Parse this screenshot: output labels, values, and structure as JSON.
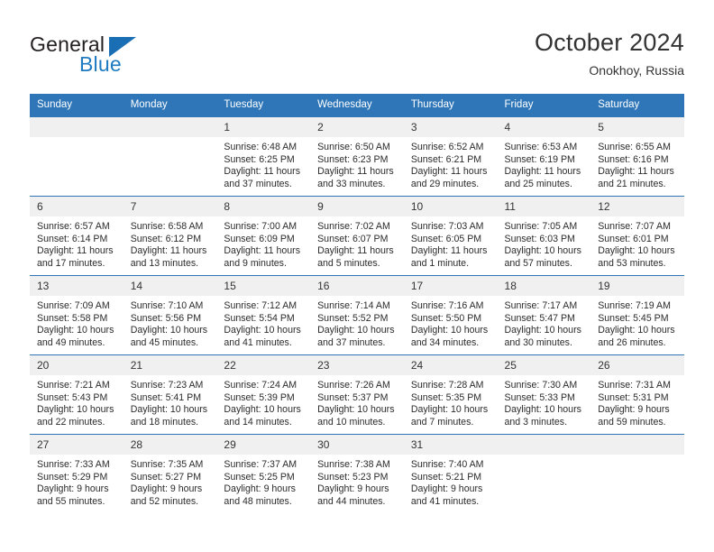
{
  "brand": {
    "name_top": "General",
    "name_bottom": "Blue",
    "triangle_color": "#1a6fb4",
    "blue_color": "#1f7ac0"
  },
  "header": {
    "title": "October 2024",
    "location": "Onokhoy, Russia"
  },
  "theme": {
    "header_blue": "#2e76b8",
    "daynum_band": "#f0f0f0",
    "text": "#2b2b2b"
  },
  "weekday_headers": [
    "Sunday",
    "Monday",
    "Tuesday",
    "Wednesday",
    "Thursday",
    "Friday",
    "Saturday"
  ],
  "weeks": [
    [
      {
        "day": "",
        "sunrise": "",
        "sunset": "",
        "daylight_line1": "",
        "daylight_line2": ""
      },
      {
        "day": "",
        "sunrise": "",
        "sunset": "",
        "daylight_line1": "",
        "daylight_line2": ""
      },
      {
        "day": "1",
        "sunrise": "Sunrise: 6:48 AM",
        "sunset": "Sunset: 6:25 PM",
        "daylight_line1": "Daylight: 11 hours",
        "daylight_line2": "and 37 minutes."
      },
      {
        "day": "2",
        "sunrise": "Sunrise: 6:50 AM",
        "sunset": "Sunset: 6:23 PM",
        "daylight_line1": "Daylight: 11 hours",
        "daylight_line2": "and 33 minutes."
      },
      {
        "day": "3",
        "sunrise": "Sunrise: 6:52 AM",
        "sunset": "Sunset: 6:21 PM",
        "daylight_line1": "Daylight: 11 hours",
        "daylight_line2": "and 29 minutes."
      },
      {
        "day": "4",
        "sunrise": "Sunrise: 6:53 AM",
        "sunset": "Sunset: 6:19 PM",
        "daylight_line1": "Daylight: 11 hours",
        "daylight_line2": "and 25 minutes."
      },
      {
        "day": "5",
        "sunrise": "Sunrise: 6:55 AM",
        "sunset": "Sunset: 6:16 PM",
        "daylight_line1": "Daylight: 11 hours",
        "daylight_line2": "and 21 minutes."
      }
    ],
    [
      {
        "day": "6",
        "sunrise": "Sunrise: 6:57 AM",
        "sunset": "Sunset: 6:14 PM",
        "daylight_line1": "Daylight: 11 hours",
        "daylight_line2": "and 17 minutes."
      },
      {
        "day": "7",
        "sunrise": "Sunrise: 6:58 AM",
        "sunset": "Sunset: 6:12 PM",
        "daylight_line1": "Daylight: 11 hours",
        "daylight_line2": "and 13 minutes."
      },
      {
        "day": "8",
        "sunrise": "Sunrise: 7:00 AM",
        "sunset": "Sunset: 6:09 PM",
        "daylight_line1": "Daylight: 11 hours",
        "daylight_line2": "and 9 minutes."
      },
      {
        "day": "9",
        "sunrise": "Sunrise: 7:02 AM",
        "sunset": "Sunset: 6:07 PM",
        "daylight_line1": "Daylight: 11 hours",
        "daylight_line2": "and 5 minutes."
      },
      {
        "day": "10",
        "sunrise": "Sunrise: 7:03 AM",
        "sunset": "Sunset: 6:05 PM",
        "daylight_line1": "Daylight: 11 hours",
        "daylight_line2": "and 1 minute."
      },
      {
        "day": "11",
        "sunrise": "Sunrise: 7:05 AM",
        "sunset": "Sunset: 6:03 PM",
        "daylight_line1": "Daylight: 10 hours",
        "daylight_line2": "and 57 minutes."
      },
      {
        "day": "12",
        "sunrise": "Sunrise: 7:07 AM",
        "sunset": "Sunset: 6:01 PM",
        "daylight_line1": "Daylight: 10 hours",
        "daylight_line2": "and 53 minutes."
      }
    ],
    [
      {
        "day": "13",
        "sunrise": "Sunrise: 7:09 AM",
        "sunset": "Sunset: 5:58 PM",
        "daylight_line1": "Daylight: 10 hours",
        "daylight_line2": "and 49 minutes."
      },
      {
        "day": "14",
        "sunrise": "Sunrise: 7:10 AM",
        "sunset": "Sunset: 5:56 PM",
        "daylight_line1": "Daylight: 10 hours",
        "daylight_line2": "and 45 minutes."
      },
      {
        "day": "15",
        "sunrise": "Sunrise: 7:12 AM",
        "sunset": "Sunset: 5:54 PM",
        "daylight_line1": "Daylight: 10 hours",
        "daylight_line2": "and 41 minutes."
      },
      {
        "day": "16",
        "sunrise": "Sunrise: 7:14 AM",
        "sunset": "Sunset: 5:52 PM",
        "daylight_line1": "Daylight: 10 hours",
        "daylight_line2": "and 37 minutes."
      },
      {
        "day": "17",
        "sunrise": "Sunrise: 7:16 AM",
        "sunset": "Sunset: 5:50 PM",
        "daylight_line1": "Daylight: 10 hours",
        "daylight_line2": "and 34 minutes."
      },
      {
        "day": "18",
        "sunrise": "Sunrise: 7:17 AM",
        "sunset": "Sunset: 5:47 PM",
        "daylight_line1": "Daylight: 10 hours",
        "daylight_line2": "and 30 minutes."
      },
      {
        "day": "19",
        "sunrise": "Sunrise: 7:19 AM",
        "sunset": "Sunset: 5:45 PM",
        "daylight_line1": "Daylight: 10 hours",
        "daylight_line2": "and 26 minutes."
      }
    ],
    [
      {
        "day": "20",
        "sunrise": "Sunrise: 7:21 AM",
        "sunset": "Sunset: 5:43 PM",
        "daylight_line1": "Daylight: 10 hours",
        "daylight_line2": "and 22 minutes."
      },
      {
        "day": "21",
        "sunrise": "Sunrise: 7:23 AM",
        "sunset": "Sunset: 5:41 PM",
        "daylight_line1": "Daylight: 10 hours",
        "daylight_line2": "and 18 minutes."
      },
      {
        "day": "22",
        "sunrise": "Sunrise: 7:24 AM",
        "sunset": "Sunset: 5:39 PM",
        "daylight_line1": "Daylight: 10 hours",
        "daylight_line2": "and 14 minutes."
      },
      {
        "day": "23",
        "sunrise": "Sunrise: 7:26 AM",
        "sunset": "Sunset: 5:37 PM",
        "daylight_line1": "Daylight: 10 hours",
        "daylight_line2": "and 10 minutes."
      },
      {
        "day": "24",
        "sunrise": "Sunrise: 7:28 AM",
        "sunset": "Sunset: 5:35 PM",
        "daylight_line1": "Daylight: 10 hours",
        "daylight_line2": "and 7 minutes."
      },
      {
        "day": "25",
        "sunrise": "Sunrise: 7:30 AM",
        "sunset": "Sunset: 5:33 PM",
        "daylight_line1": "Daylight: 10 hours",
        "daylight_line2": "and 3 minutes."
      },
      {
        "day": "26",
        "sunrise": "Sunrise: 7:31 AM",
        "sunset": "Sunset: 5:31 PM",
        "daylight_line1": "Daylight: 9 hours",
        "daylight_line2": "and 59 minutes."
      }
    ],
    [
      {
        "day": "27",
        "sunrise": "Sunrise: 7:33 AM",
        "sunset": "Sunset: 5:29 PM",
        "daylight_line1": "Daylight: 9 hours",
        "daylight_line2": "and 55 minutes."
      },
      {
        "day": "28",
        "sunrise": "Sunrise: 7:35 AM",
        "sunset": "Sunset: 5:27 PM",
        "daylight_line1": "Daylight: 9 hours",
        "daylight_line2": "and 52 minutes."
      },
      {
        "day": "29",
        "sunrise": "Sunrise: 7:37 AM",
        "sunset": "Sunset: 5:25 PM",
        "daylight_line1": "Daylight: 9 hours",
        "daylight_line2": "and 48 minutes."
      },
      {
        "day": "30",
        "sunrise": "Sunrise: 7:38 AM",
        "sunset": "Sunset: 5:23 PM",
        "daylight_line1": "Daylight: 9 hours",
        "daylight_line2": "and 44 minutes."
      },
      {
        "day": "31",
        "sunrise": "Sunrise: 7:40 AM",
        "sunset": "Sunset: 5:21 PM",
        "daylight_line1": "Daylight: 9 hours",
        "daylight_line2": "and 41 minutes."
      },
      {
        "day": "",
        "sunrise": "",
        "sunset": "",
        "daylight_line1": "",
        "daylight_line2": ""
      },
      {
        "day": "",
        "sunrise": "",
        "sunset": "",
        "daylight_line1": "",
        "daylight_line2": ""
      }
    ]
  ]
}
